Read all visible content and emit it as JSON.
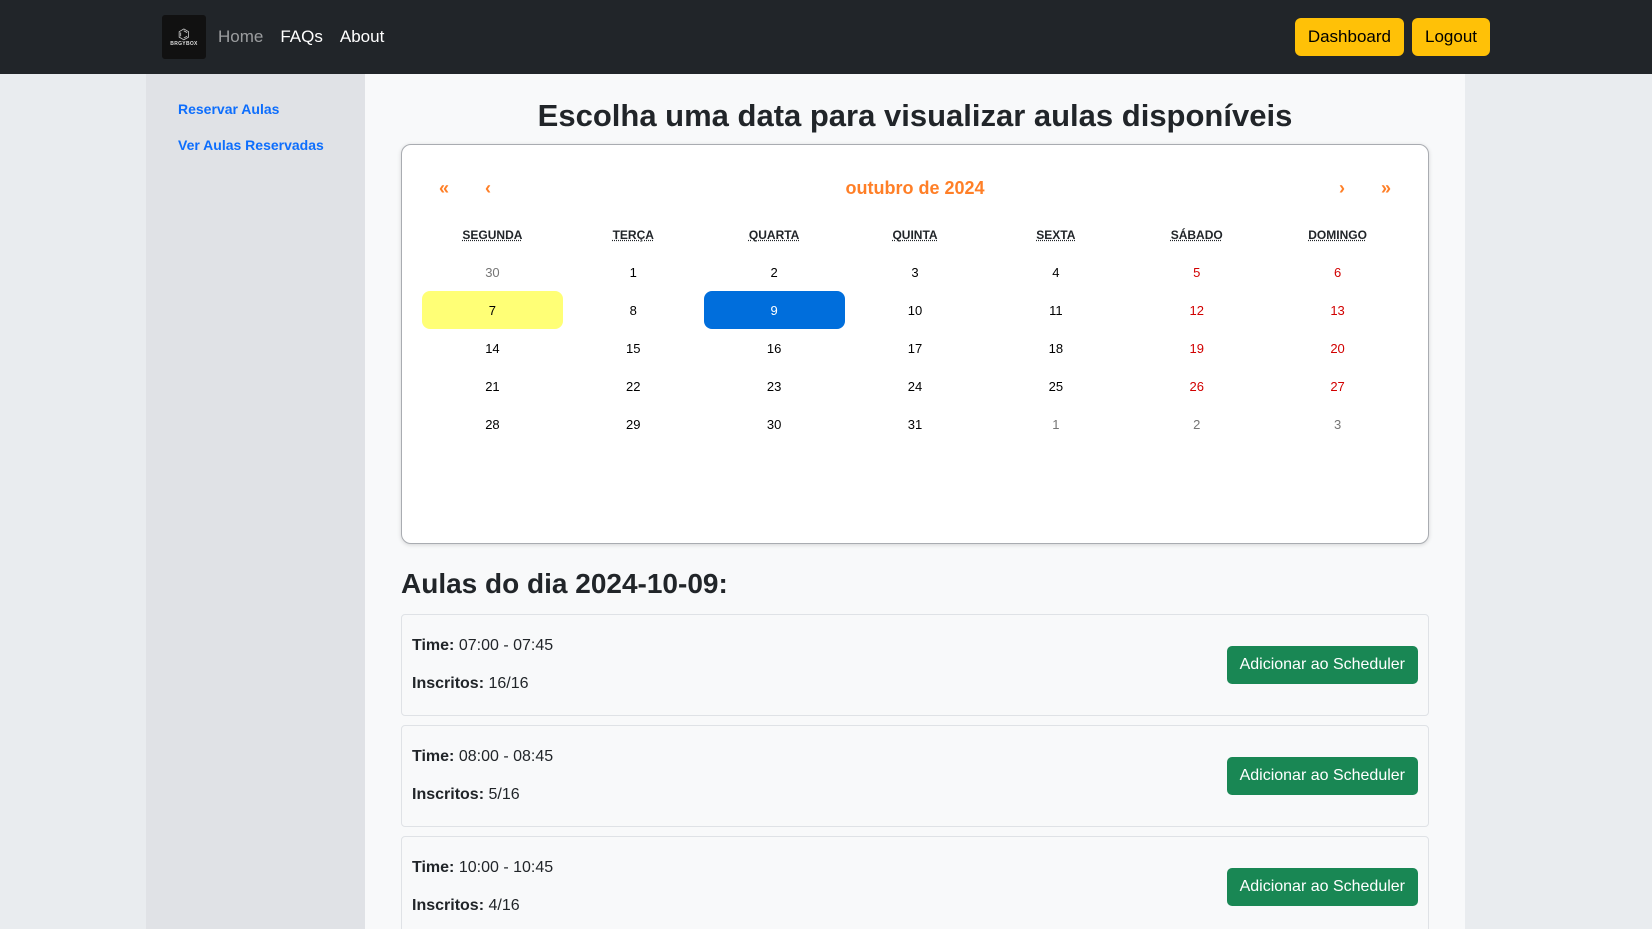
{
  "navbar": {
    "logo_text": "BRGYBOX",
    "links": [
      {
        "label": "Home",
        "dim": true
      },
      {
        "label": "FAQs",
        "dim": false
      },
      {
        "label": "About",
        "dim": false
      }
    ],
    "dashboard_label": "Dashboard",
    "logout_label": "Logout"
  },
  "sidebar": {
    "items": [
      {
        "label": "Reservar Aulas"
      },
      {
        "label": "Ver Aulas Reservadas"
      }
    ]
  },
  "main": {
    "title": "Escolha uma data para visualizar aulas disponíveis",
    "calendar": {
      "label": "outubro de 2024",
      "prev2": "«",
      "prev": "‹",
      "next": "›",
      "next2": "»",
      "accent_color": "#ff7f27",
      "weekdays": [
        "SEGUNDA",
        "TERÇA",
        "QUARTA",
        "QUINTA",
        "SEXTA",
        "SÁBADO",
        "DOMINGO"
      ],
      "weeks": [
        [
          {
            "d": "30",
            "t": "neighbor"
          },
          {
            "d": "1"
          },
          {
            "d": "2"
          },
          {
            "d": "3"
          },
          {
            "d": "4"
          },
          {
            "d": "5",
            "t": "weekend"
          },
          {
            "d": "6",
            "t": "weekend"
          }
        ],
        [
          {
            "d": "7",
            "t": "today"
          },
          {
            "d": "8"
          },
          {
            "d": "9",
            "t": "active"
          },
          {
            "d": "10"
          },
          {
            "d": "11"
          },
          {
            "d": "12",
            "t": "weekend"
          },
          {
            "d": "13",
            "t": "weekend"
          }
        ],
        [
          {
            "d": "14"
          },
          {
            "d": "15"
          },
          {
            "d": "16"
          },
          {
            "d": "17"
          },
          {
            "d": "18"
          },
          {
            "d": "19",
            "t": "weekend"
          },
          {
            "d": "20",
            "t": "weekend"
          }
        ],
        [
          {
            "d": "21"
          },
          {
            "d": "22"
          },
          {
            "d": "23"
          },
          {
            "d": "24"
          },
          {
            "d": "25"
          },
          {
            "d": "26",
            "t": "weekend"
          },
          {
            "d": "27",
            "t": "weekend"
          }
        ],
        [
          {
            "d": "28"
          },
          {
            "d": "29"
          },
          {
            "d": "30"
          },
          {
            "d": "31"
          },
          {
            "d": "1",
            "t": "neighbor"
          },
          {
            "d": "2",
            "t": "neighbor"
          },
          {
            "d": "3",
            "t": "neighbor"
          }
        ]
      ]
    },
    "classes_title": "Aulas do dia 2024-10-09:",
    "time_label": "Time:",
    "enrolled_label": "Inscritos:",
    "add_button_label": "Adicionar ao Scheduler",
    "classes": [
      {
        "time": "07:00 - 07:45",
        "enrolled": "16/16"
      },
      {
        "time": "08:00 - 08:45",
        "enrolled": "5/16"
      },
      {
        "time": "10:00 - 10:45",
        "enrolled": "4/16"
      }
    ]
  }
}
